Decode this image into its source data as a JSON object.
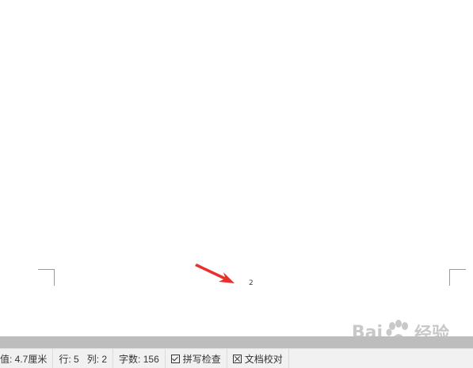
{
  "document": {
    "page_number": "2"
  },
  "status_bar": {
    "position_value": "值: 4.7厘米",
    "line": "行: 5",
    "column": "列: 2",
    "word_count": "字数: 156",
    "spell_check_label": "拼写检查",
    "doc_proofread_label": "文档校对"
  },
  "watermark": {
    "brand_text": "Bai",
    "brand_suffix": "经验"
  },
  "colors": {
    "arrow": "#e8302c",
    "scroll_track": "#bdbdbd",
    "status_bg": "#f1f1f1"
  },
  "icons": {
    "spell_check": "checkbox-check-icon",
    "doc_proofread": "checkbox-cross-icon",
    "annotation": "red-arrow-icon"
  }
}
